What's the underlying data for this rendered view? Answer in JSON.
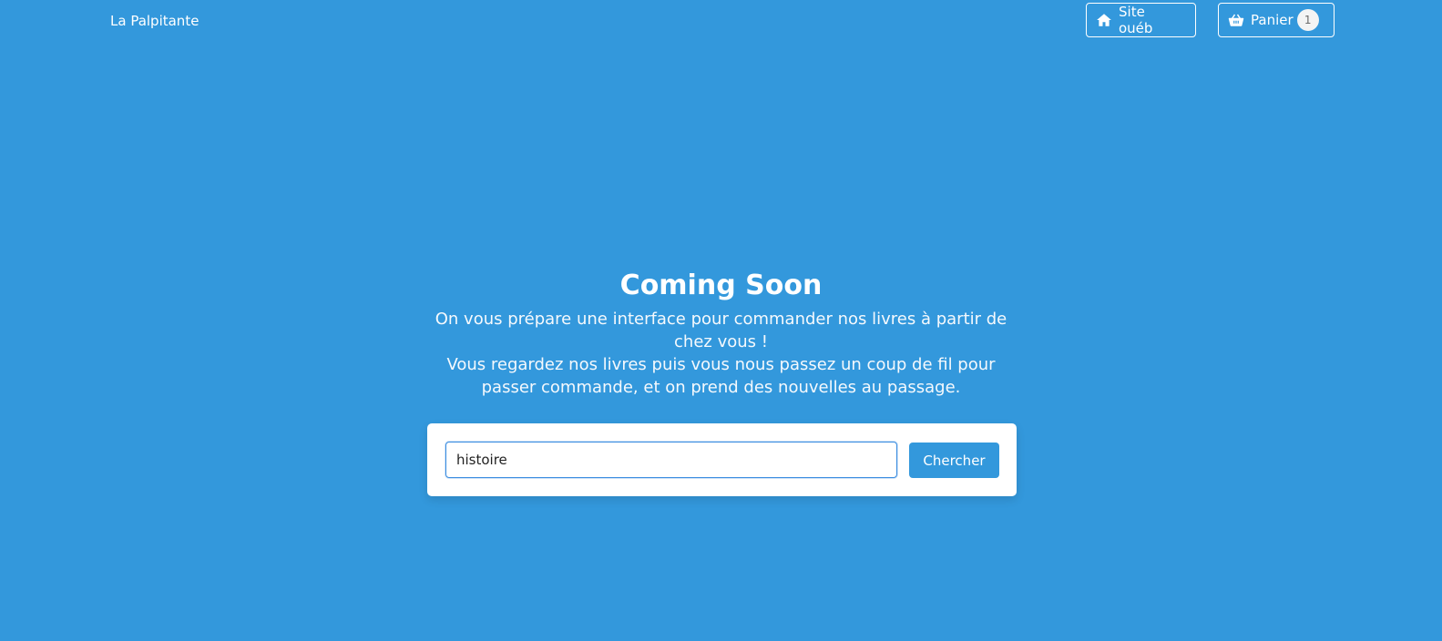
{
  "header": {
    "brand": "La Palpitante",
    "site_button": {
      "label": "Site ouéb",
      "icon": "home-icon"
    },
    "cart_button": {
      "label": "Panier",
      "icon": "basket-icon",
      "count": "1"
    }
  },
  "hero": {
    "title": "Coming Soon",
    "subtitle_line1": "On vous prépare une interface pour commander nos livres à partir de chez vous !",
    "subtitle_line2": "Vous regardez nos livres puis vous nous passez un coup de fil pour passer commande, et on prend des nouvelles au passage."
  },
  "search": {
    "value": "histoire",
    "button_label": "Chercher"
  },
  "colors": {
    "background": "#3398dc",
    "accent": "#3398dc",
    "card": "#ffffff"
  }
}
